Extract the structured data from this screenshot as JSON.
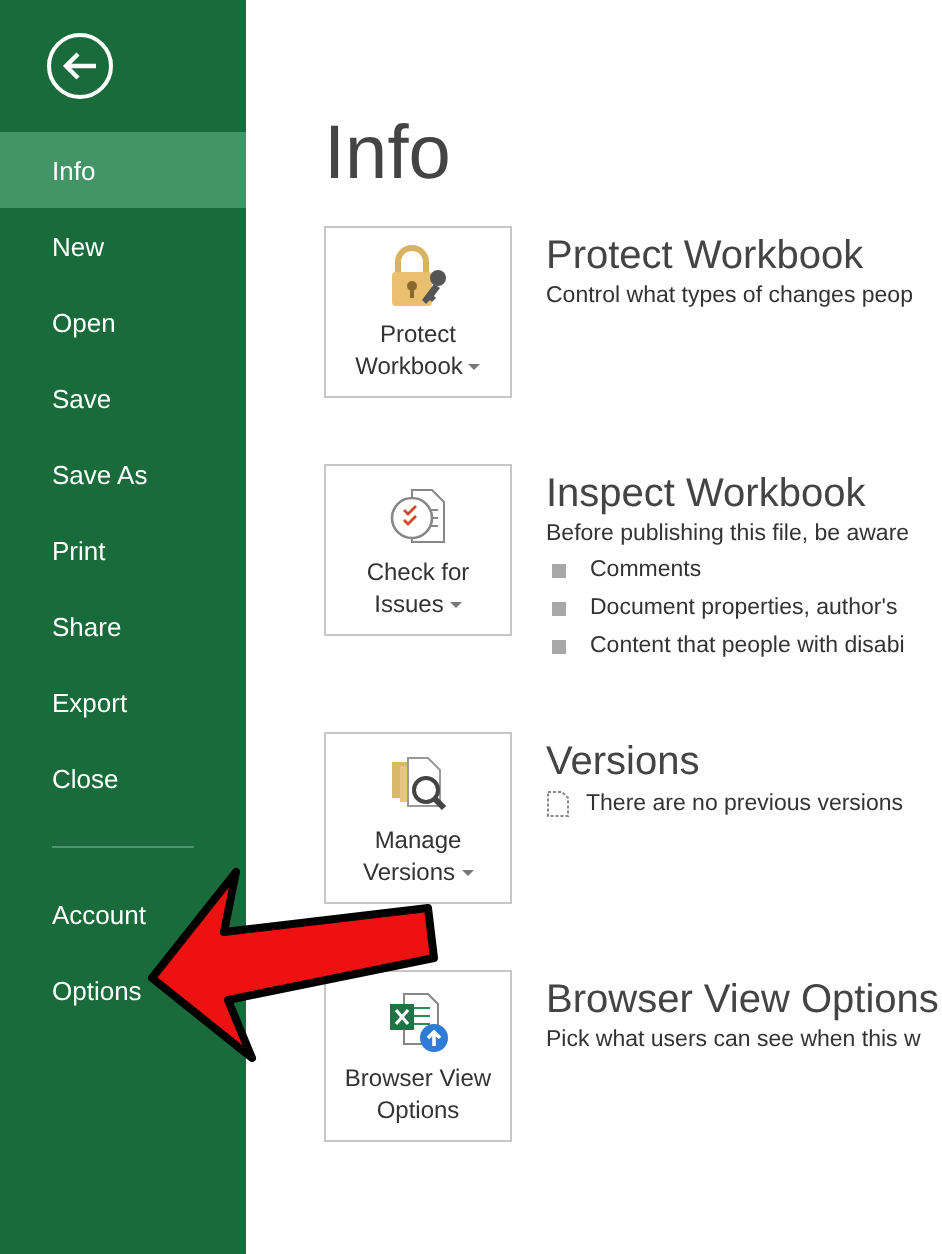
{
  "sidebar": {
    "items": [
      {
        "label": "Info",
        "selected": true
      },
      {
        "label": "New",
        "selected": false
      },
      {
        "label": "Open",
        "selected": false
      },
      {
        "label": "Save",
        "selected": false
      },
      {
        "label": "Save As",
        "selected": false
      },
      {
        "label": "Print",
        "selected": false
      },
      {
        "label": "Share",
        "selected": false
      },
      {
        "label": "Export",
        "selected": false
      },
      {
        "label": "Close",
        "selected": false
      },
      {
        "kind": "divider"
      },
      {
        "label": "Account",
        "selected": false
      },
      {
        "label": "Options",
        "selected": false
      }
    ]
  },
  "title": "Info",
  "sections": [
    {
      "kind": "lock",
      "button": "Protect Workbook",
      "dropdown": true,
      "heading": "Protect Workbook",
      "description": "Control what types of changes peop"
    },
    {
      "kind": "inspect",
      "button": "Check for Issues",
      "dropdown": true,
      "heading": "Inspect Workbook",
      "description": "Before publishing this file, be aware",
      "bullets": [
        "Comments",
        "Document properties, author's",
        "Content that people with disabi"
      ]
    },
    {
      "kind": "versions",
      "button": "Manage Versions",
      "dropdown": true,
      "heading": "Versions",
      "note": "There are no previous versions"
    },
    {
      "kind": "browser",
      "button": "Browser View Options",
      "dropdown": false,
      "heading": "Browser View Options",
      "description": "Pick what users can see when this w"
    }
  ],
  "annotation": {
    "kind": "arrow"
  }
}
